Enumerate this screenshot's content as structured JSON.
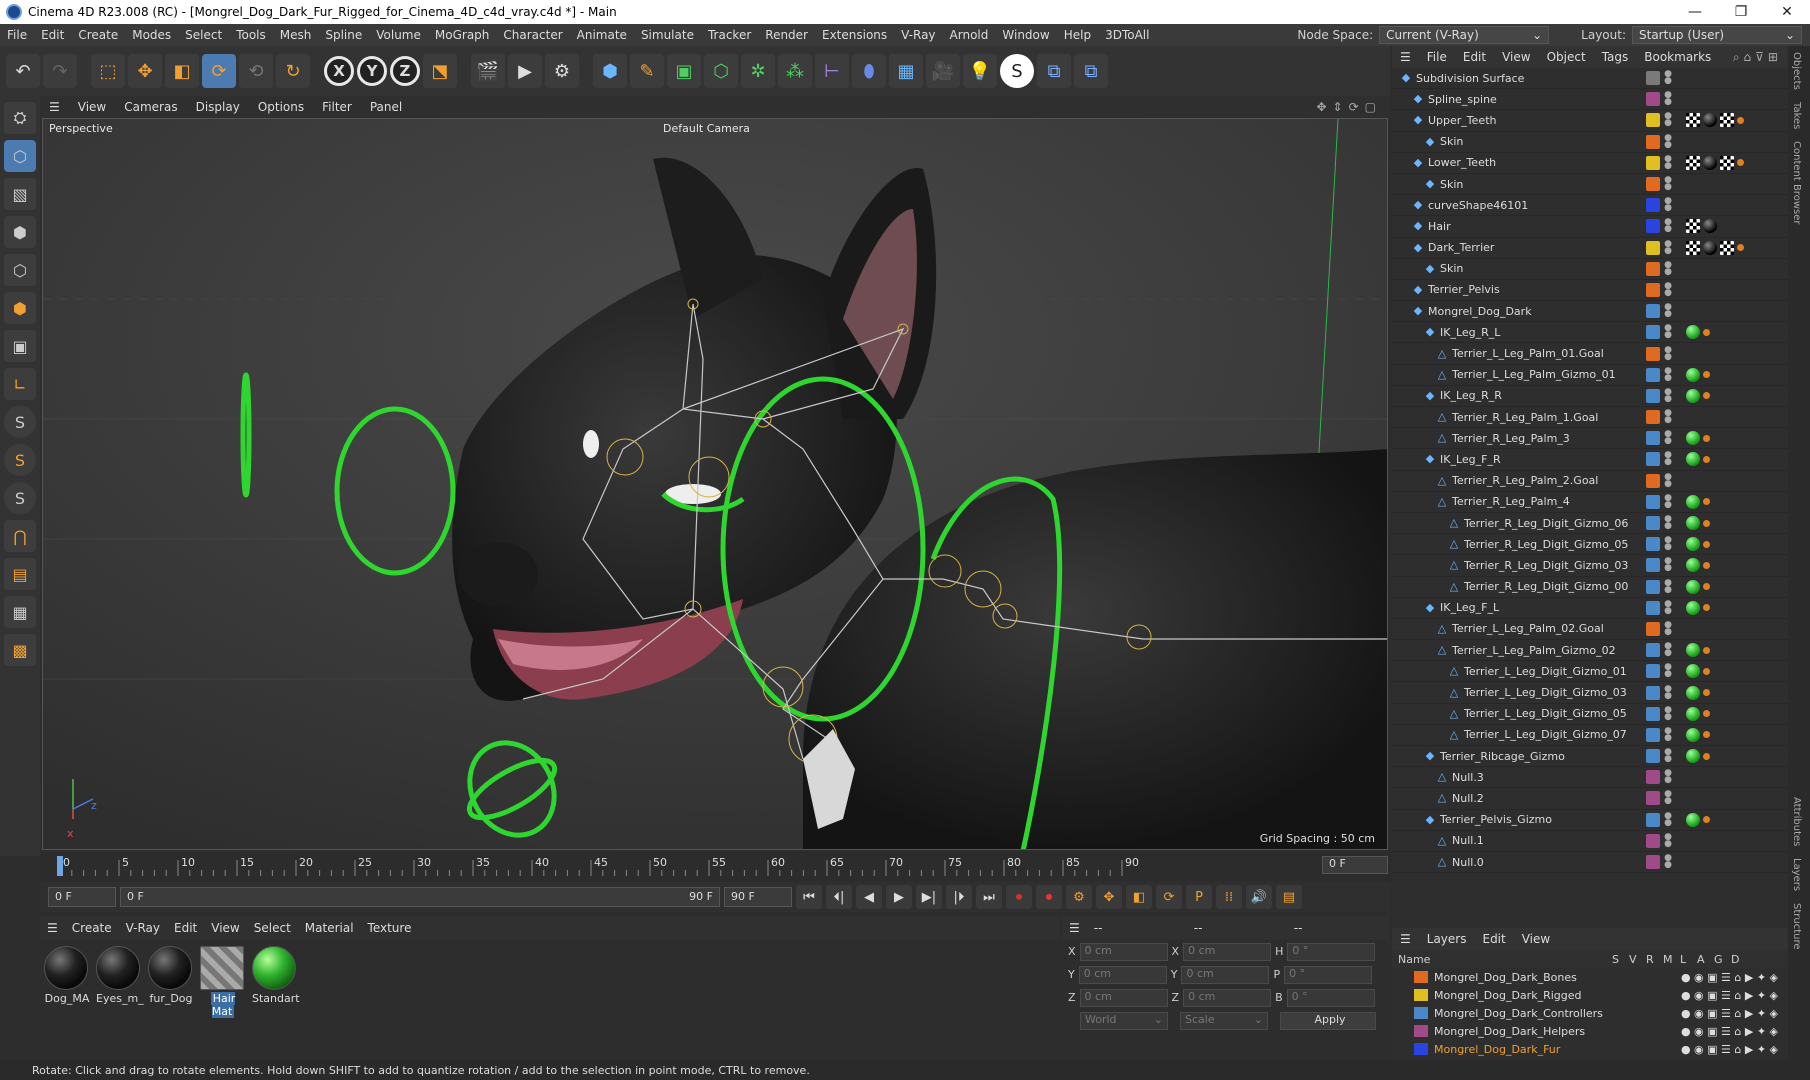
{
  "window": {
    "title": "Cinema 4D R23.008 (RC) - [Mongrel_Dog_Dark_Fur_Rigged_for_Cinema_4D_c4d_vray.c4d *] - Main",
    "controls": [
      "—",
      "❐",
      "✕"
    ]
  },
  "menubar": {
    "items": [
      "File",
      "Edit",
      "Create",
      "Modes",
      "Select",
      "Tools",
      "Mesh",
      "Spline",
      "Volume",
      "MoGraph",
      "Character",
      "Animate",
      "Simulate",
      "Tracker",
      "Render",
      "Extensions",
      "V-Ray",
      "Arnold",
      "Window",
      "Help",
      "3DToAll"
    ],
    "node_space_label": "Node Space:",
    "node_space_value": "Current (V-Ray)",
    "layout_label": "Layout:",
    "layout_value": "Startup (User)"
  },
  "viewport": {
    "menu": [
      "View",
      "Cameras",
      "Display",
      "Options",
      "Filter",
      "Panel"
    ],
    "label": "Perspective",
    "camera": "Default Camera",
    "grid_spacing": "Grid Spacing : 50 cm"
  },
  "timeline": {
    "ticks": [
      "0",
      "5",
      "10",
      "15",
      "20",
      "25",
      "30",
      "35",
      "40",
      "45",
      "50",
      "55",
      "60",
      "65",
      "70",
      "75",
      "80",
      "85",
      "90"
    ],
    "current_frame": "0 F"
  },
  "transport": {
    "start": "0 F",
    "range_start": "0 F",
    "range_end": "90 F",
    "end": "90 F"
  },
  "materials": {
    "menu": [
      "Create",
      "V-Ray",
      "Edit",
      "View",
      "Select",
      "Material",
      "Texture"
    ],
    "items": [
      {
        "name": "Dog_MA",
        "kind": "dark"
      },
      {
        "name": "Eyes_m_",
        "kind": "dark"
      },
      {
        "name": "fur_Dog",
        "kind": "dark"
      },
      {
        "name": "Hair Mat",
        "kind": "hair"
      },
      {
        "name": "Standart",
        "kind": "green"
      }
    ]
  },
  "coordinates": {
    "header": [
      "--",
      "--",
      "--"
    ],
    "rows": [
      {
        "a": "X",
        "av": "0 cm",
        "b": "X",
        "bv": "0 cm",
        "c": "H",
        "cv": "0 °"
      },
      {
        "a": "Y",
        "av": "0 cm",
        "b": "Y",
        "bv": "0 cm",
        "c": "P",
        "cv": "0 °"
      },
      {
        "a": "Z",
        "av": "0 cm",
        "b": "Z",
        "bv": "0 cm",
        "c": "B",
        "cv": "0 °"
      }
    ],
    "mode": "World",
    "scale": "Scale",
    "apply": "Apply"
  },
  "object_manager": {
    "menu": [
      "File",
      "Edit",
      "View",
      "Object",
      "Tags",
      "Bookmarks"
    ],
    "rows": [
      {
        "name": "Subdivision Surface",
        "indent": 0,
        "layer": "#7a7a7a",
        "tags": []
      },
      {
        "name": "Spline_spine",
        "indent": 1,
        "layer": "#a04a8a",
        "tags": []
      },
      {
        "name": "Upper_Teeth",
        "indent": 1,
        "layer": "#e0c020",
        "tags": [
          "c",
          "b",
          "c",
          "o"
        ]
      },
      {
        "name": "Skin",
        "indent": 2,
        "layer": "#e06a20",
        "tags": []
      },
      {
        "name": "Lower_Teeth",
        "indent": 1,
        "layer": "#e0c020",
        "tags": [
          "c",
          "b",
          "c",
          "o"
        ]
      },
      {
        "name": "Skin",
        "indent": 2,
        "layer": "#e06a20",
        "tags": []
      },
      {
        "name": "curveShape46101",
        "indent": 1,
        "layer": "#2a44e0",
        "tags": []
      },
      {
        "name": "Hair",
        "indent": 1,
        "layer": "#2a44e0",
        "tags": [
          "c",
          "b"
        ]
      },
      {
        "name": "Dark_Terrier",
        "indent": 1,
        "layer": "#e0c020",
        "tags": [
          "c",
          "b",
          "c",
          "o"
        ]
      },
      {
        "name": "Skin",
        "indent": 2,
        "layer": "#e06a20",
        "tags": []
      },
      {
        "name": "Terrier_Pelvis",
        "indent": 1,
        "layer": "#e06a20",
        "tags": []
      },
      {
        "name": "Mongrel_Dog_Dark",
        "indent": 1,
        "layer": "#4a88c8",
        "tags": []
      },
      {
        "name": "IK_Leg_R_L",
        "indent": 2,
        "layer": "#4a88c8",
        "tags": [
          "g",
          "o"
        ]
      },
      {
        "name": "Terrier_L_Leg_Palm_01.Goal",
        "indent": 3,
        "layer": "#e06a20",
        "tags": []
      },
      {
        "name": "Terrier_L_Leg_Palm_Gizmo_01",
        "indent": 3,
        "layer": "#4a88c8",
        "tags": [
          "g",
          "o"
        ]
      },
      {
        "name": "IK_Leg_R_R",
        "indent": 2,
        "layer": "#4a88c8",
        "tags": [
          "g",
          "o"
        ]
      },
      {
        "name": "Terrier_R_Leg_Palm_1.Goal",
        "indent": 3,
        "layer": "#e06a20",
        "tags": []
      },
      {
        "name": "Terrier_R_Leg_Palm_3",
        "indent": 3,
        "layer": "#4a88c8",
        "tags": [
          "g",
          "o"
        ]
      },
      {
        "name": "IK_Leg_F_R",
        "indent": 2,
        "layer": "#4a88c8",
        "tags": [
          "g",
          "o"
        ]
      },
      {
        "name": "Terrier_R_Leg_Palm_2.Goal",
        "indent": 3,
        "layer": "#e06a20",
        "tags": []
      },
      {
        "name": "Terrier_R_Leg_Palm_4",
        "indent": 3,
        "layer": "#4a88c8",
        "tags": [
          "g",
          "o"
        ]
      },
      {
        "name": "Terrier_R_Leg_Digit_Gizmo_06",
        "indent": 4,
        "layer": "#4a88c8",
        "tags": [
          "g",
          "o"
        ]
      },
      {
        "name": "Terrier_R_Leg_Digit_Gizmo_05",
        "indent": 4,
        "layer": "#4a88c8",
        "tags": [
          "g",
          "o"
        ]
      },
      {
        "name": "Terrier_R_Leg_Digit_Gizmo_03",
        "indent": 4,
        "layer": "#4a88c8",
        "tags": [
          "g",
          "o"
        ]
      },
      {
        "name": "Terrier_R_Leg_Digit_Gizmo_00",
        "indent": 4,
        "layer": "#4a88c8",
        "tags": [
          "g",
          "o"
        ]
      },
      {
        "name": "IK_Leg_F_L",
        "indent": 2,
        "layer": "#4a88c8",
        "tags": [
          "g",
          "o"
        ]
      },
      {
        "name": "Terrier_L_Leg_Palm_02.Goal",
        "indent": 3,
        "layer": "#e06a20",
        "tags": []
      },
      {
        "name": "Terrier_L_Leg_Palm_Gizmo_02",
        "indent": 3,
        "layer": "#4a88c8",
        "tags": [
          "g",
          "o"
        ]
      },
      {
        "name": "Terrier_L_Leg_Digit_Gizmo_01",
        "indent": 4,
        "layer": "#4a88c8",
        "tags": [
          "g",
          "o"
        ]
      },
      {
        "name": "Terrier_L_Leg_Digit_Gizmo_03",
        "indent": 4,
        "layer": "#4a88c8",
        "tags": [
          "g",
          "o"
        ]
      },
      {
        "name": "Terrier_L_Leg_Digit_Gizmo_05",
        "indent": 4,
        "layer": "#4a88c8",
        "tags": [
          "g",
          "o"
        ]
      },
      {
        "name": "Terrier_L_Leg_Digit_Gizmo_07",
        "indent": 4,
        "layer": "#4a88c8",
        "tags": [
          "g",
          "o"
        ]
      },
      {
        "name": "Terrier_Ribcage_Gizmo",
        "indent": 2,
        "layer": "#4a88c8",
        "tags": [
          "g",
          "o"
        ]
      },
      {
        "name": "Null.3",
        "indent": 3,
        "layer": "#a04a8a",
        "tags": []
      },
      {
        "name": "Null.2",
        "indent": 3,
        "layer": "#a04a8a",
        "tags": []
      },
      {
        "name": "Terrier_Pelvis_Gizmo",
        "indent": 2,
        "layer": "#4a88c8",
        "tags": [
          "g",
          "o"
        ]
      },
      {
        "name": "Null.1",
        "indent": 3,
        "layer": "#a04a8a",
        "tags": []
      },
      {
        "name": "Null.0",
        "indent": 3,
        "layer": "#a04a8a",
        "tags": []
      }
    ]
  },
  "side_tabs": [
    "Objects",
    "Takes",
    "Content Browser",
    "Attributes",
    "Layers",
    "Structure"
  ],
  "layers": {
    "menu": [
      "Layers",
      "Edit",
      "View"
    ],
    "columns": [
      "Name",
      "S",
      "V",
      "R",
      "M",
      "L",
      "A",
      "G",
      "D"
    ],
    "rows": [
      {
        "name": "Mongrel_Dog_Dark_Bones",
        "color": "#e06a20"
      },
      {
        "name": "Mongrel_Dog_Dark_Rigged",
        "color": "#e0c020"
      },
      {
        "name": "Mongrel_Dog_Dark_Controllers",
        "color": "#4a88c8"
      },
      {
        "name": "Mongrel_Dog_Dark_Helpers",
        "color": "#a04a8a"
      },
      {
        "name": "Mongrel_Dog_Dark_Fur",
        "color": "#2a44e0"
      }
    ]
  },
  "status": "Rotate: Click and drag to rotate elements. Hold down SHIFT to add to quantize rotation / add to the selection in point mode, CTRL to remove."
}
